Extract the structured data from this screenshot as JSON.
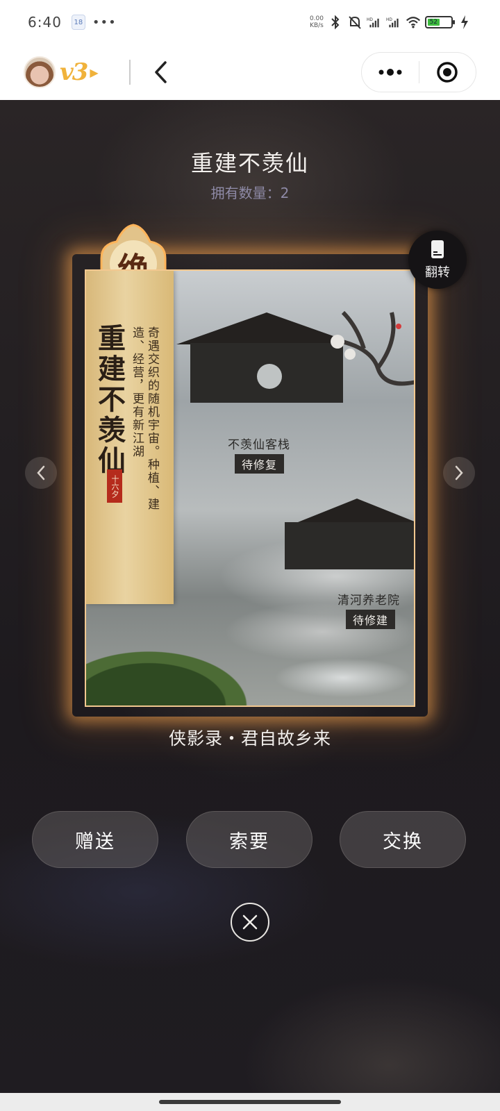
{
  "status_bar": {
    "time": "6:40",
    "notification_badge": "18",
    "more": "•••",
    "net_speed": "0.00\nKB/s",
    "battery": "52",
    "icons": [
      "bluetooth-icon",
      "mute-bell-icon",
      "signal-hd-icon",
      "signal-hd-icon",
      "wifi-icon",
      "battery-icon",
      "charging-icon"
    ]
  },
  "header": {
    "vip_level": "v3",
    "icons": [
      "avatar",
      "back-chevron-icon",
      "more-dots-icon",
      "record-circle-icon"
    ]
  },
  "card": {
    "title": "重建不羡仙",
    "owned_count": "拥有数量：2",
    "rank": "绝",
    "scroll_title": "重建不羡仙",
    "seal_text": "十六夕",
    "description": "奇遇交织的随机宇宙。种植、建造、经营，更有新江湖",
    "place_1": "不羡仙客栈",
    "place_1_status": "待修复",
    "place_2": "清河养老院",
    "place_2_status": "待修建",
    "set_name": "侠影录・君自故乡来"
  },
  "flip_label": "翻转",
  "actions": {
    "gift": "赠送",
    "request": "索要",
    "exchange": "交换"
  },
  "colors": {
    "accent_gold": "#f0b23b",
    "glow": "#ffaa50",
    "background": "#1e1b1f"
  }
}
